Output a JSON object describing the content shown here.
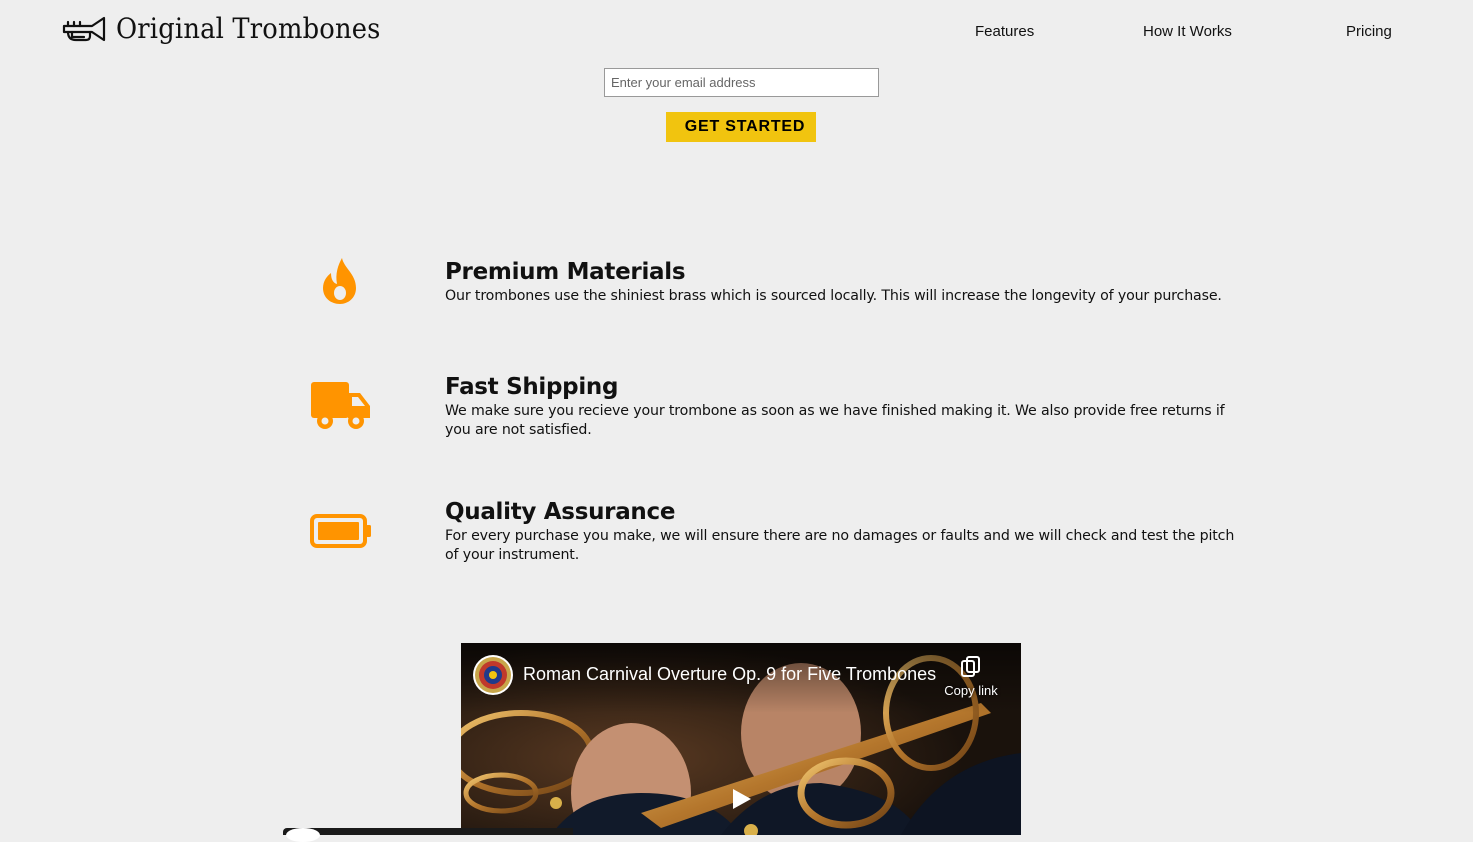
{
  "header": {
    "brand": "Original Trombones",
    "logo_icon": "trumpet-logo-icon",
    "nav": [
      {
        "label": "Features"
      },
      {
        "label": "How It Works"
      },
      {
        "label": "Pricing"
      }
    ]
  },
  "form": {
    "email_placeholder": "Enter your email address",
    "email_value": "",
    "submit_label": "GET STARTED"
  },
  "colors": {
    "accent": "#f1c40f",
    "icon": "#ff9400",
    "background": "#eeeeee"
  },
  "features": [
    {
      "icon": "fire-icon",
      "title": "Premium Materials",
      "description": "Our trombones use the shiniest brass which is sourced locally. This will increase the longevity of your purchase."
    },
    {
      "icon": "truck-icon",
      "title": "Fast Shipping",
      "description": "We make sure you recieve your trombone as soon as we have finished making it. We also provide free returns if you are not satisfied."
    },
    {
      "icon": "battery-icon",
      "title": "Quality Assurance",
      "description": "For every purchase you make, we will ensure there are no damages or faults and we will check and test the pitch of your instrument."
    }
  ],
  "video": {
    "title": "Roman Carnival Overture Op. 9 for Five Trombones",
    "copy_link_label": "Copy link"
  }
}
